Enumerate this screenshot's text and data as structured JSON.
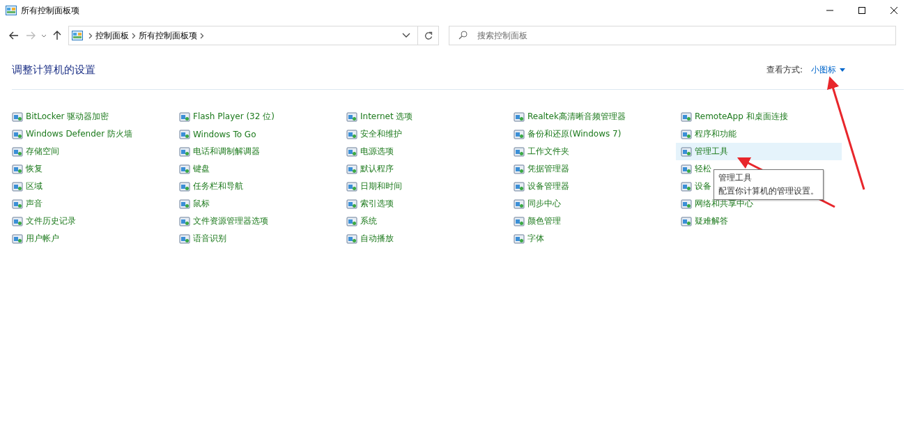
{
  "window": {
    "title": "所有控制面板项"
  },
  "address_bar": {
    "breadcrumbs": [
      "控制面板",
      "所有控制面板项"
    ]
  },
  "search": {
    "placeholder": "搜索控制面板"
  },
  "heading": "调整计算机的设置",
  "view_by": {
    "label": "查看方式:",
    "value": "小图标"
  },
  "columns": [
    [
      {
        "label": "BitLocker 驱动器加密",
        "hovered": false
      },
      {
        "label": "Windows Defender 防火墙",
        "hovered": false
      },
      {
        "label": "存储空间",
        "hovered": false
      },
      {
        "label": "恢复",
        "hovered": false
      },
      {
        "label": "区域",
        "hovered": false
      },
      {
        "label": "声音",
        "hovered": false
      },
      {
        "label": "文件历史记录",
        "hovered": false
      },
      {
        "label": "用户帐户",
        "hovered": false
      }
    ],
    [
      {
        "label": "Flash Player (32 位)",
        "hovered": false
      },
      {
        "label": "Windows To Go",
        "hovered": false
      },
      {
        "label": "电话和调制解调器",
        "hovered": false
      },
      {
        "label": "键盘",
        "hovered": false
      },
      {
        "label": "任务栏和导航",
        "hovered": false
      },
      {
        "label": "鼠标",
        "hovered": false
      },
      {
        "label": "文件资源管理器选项",
        "hovered": false
      },
      {
        "label": "语音识别",
        "hovered": false
      }
    ],
    [
      {
        "label": "Internet 选项",
        "hovered": false
      },
      {
        "label": "安全和维护",
        "hovered": false
      },
      {
        "label": "电源选项",
        "hovered": false
      },
      {
        "label": "默认程序",
        "hovered": false
      },
      {
        "label": "日期和时间",
        "hovered": false
      },
      {
        "label": "索引选项",
        "hovered": false
      },
      {
        "label": "系统",
        "hovered": false
      },
      {
        "label": "自动播放",
        "hovered": false
      }
    ],
    [
      {
        "label": "Realtek高清晰音频管理器",
        "hovered": false
      },
      {
        "label": "备份和还原(Windows 7)",
        "hovered": false
      },
      {
        "label": "工作文件夹",
        "hovered": false
      },
      {
        "label": "凭据管理器",
        "hovered": false
      },
      {
        "label": "设备管理器",
        "hovered": false
      },
      {
        "label": "同步中心",
        "hovered": false
      },
      {
        "label": "颜色管理",
        "hovered": false
      },
      {
        "label": "字体",
        "hovered": false
      }
    ],
    [
      {
        "label": "RemoteApp 和桌面连接",
        "hovered": false
      },
      {
        "label": "程序和功能",
        "hovered": false
      },
      {
        "label": "管理工具",
        "hovered": true
      },
      {
        "label": "轻松",
        "hovered": false
      },
      {
        "label": "设备",
        "hovered": false
      },
      {
        "label": "网络和共享中心",
        "hovered": false
      },
      {
        "label": "疑难解答",
        "hovered": false
      }
    ]
  ],
  "tooltip": {
    "title": "管理工具",
    "description": "配置你计算机的管理设置。"
  }
}
